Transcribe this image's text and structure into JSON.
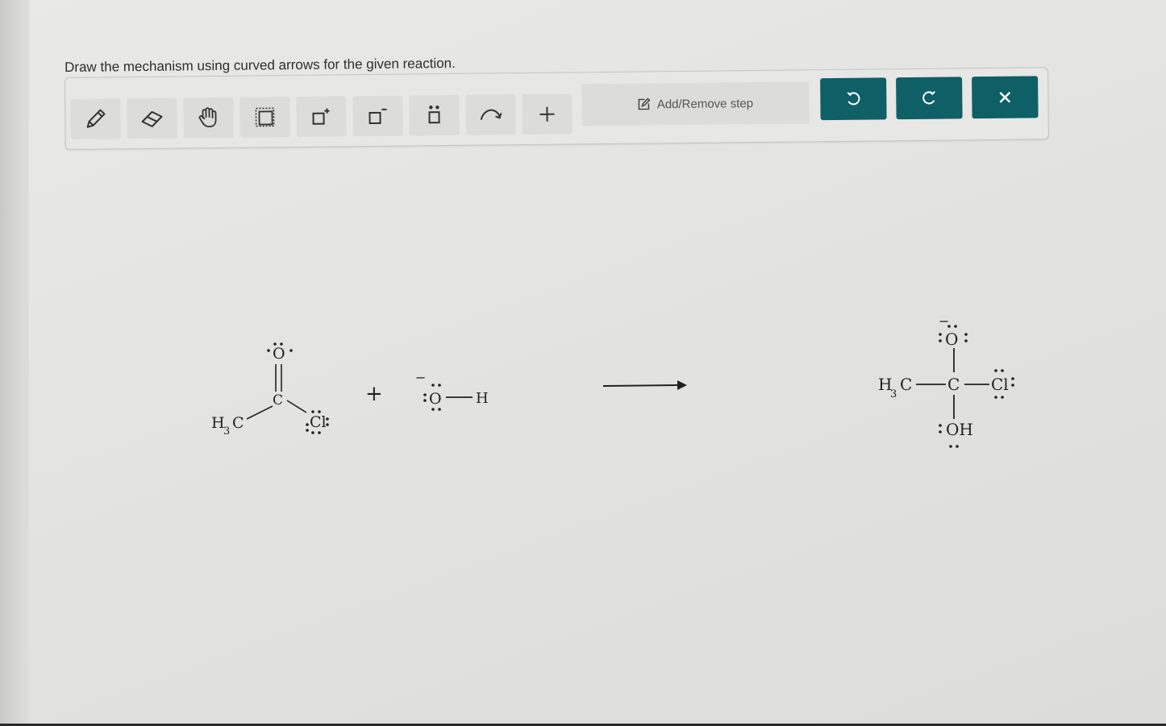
{
  "prompt": "Draw the mechanism using curved arrows for the given reaction.",
  "toolbar": {
    "tools": [
      {
        "name": "pencil-icon",
        "label": "pencil"
      },
      {
        "name": "eraser-icon",
        "label": "eraser"
      },
      {
        "name": "hand-icon",
        "label": "move"
      },
      {
        "name": "select-icon",
        "label": "select"
      },
      {
        "name": "positive-charge-icon",
        "label": "add positive charge"
      },
      {
        "name": "negative-charge-icon",
        "label": "add negative charge"
      },
      {
        "name": "lone-pair-icon",
        "label": "lone pair"
      },
      {
        "name": "curved-arrow-icon",
        "label": "curved arrow"
      },
      {
        "name": "plus-icon",
        "label": "plus"
      }
    ],
    "step_button_label": "Add/Remove step",
    "undo_icon": "undo-icon",
    "redo_icon": "redo-icon",
    "close_icon": "close-icon",
    "accent_color": "#0f5f66"
  },
  "reaction": {
    "reactant1": {
      "h3c": "H",
      "sub": "3",
      "c": "C",
      "o": "O",
      "cl": "Cl"
    },
    "plus": "+",
    "reactant2": {
      "charge": "−",
      "o": "O",
      "h": "H"
    },
    "product": {
      "h3c": "H",
      "sub": "3",
      "c": "C",
      "o": "O",
      "charge": "−",
      "cl": "Cl",
      "oh": "OH"
    }
  }
}
